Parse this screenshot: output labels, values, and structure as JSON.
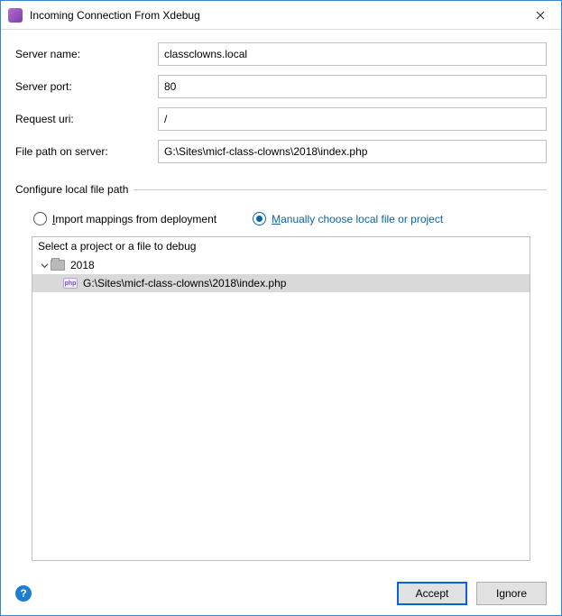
{
  "titlebar": {
    "title": "Incoming Connection From Xdebug"
  },
  "form": {
    "server_name_label": "Server name:",
    "server_name_value": "classclowns.local",
    "server_port_label": "Server port:",
    "server_port_value": "80",
    "request_uri_label": "Request uri:",
    "request_uri_value": "/",
    "file_path_label": "File path on server:",
    "file_path_value": "G:\\Sites\\micf-class-clowns\\2018\\index.php"
  },
  "section": {
    "legend": "Configure local file path",
    "radio_import_prefix": "I",
    "radio_import_rest": "mport mappings from deployment",
    "radio_manual_prefix": "M",
    "radio_manual_rest": "anually choose local file or project",
    "selected": "manual",
    "tree_header": "Select a project or a file to debug",
    "tree": {
      "root_label": "2018",
      "child_label": "G:\\Sites\\micf-class-clowns\\2018\\index.php",
      "php_badge": "php"
    }
  },
  "footer": {
    "accept_label": "Accept",
    "ignore_label": "Ignore"
  }
}
